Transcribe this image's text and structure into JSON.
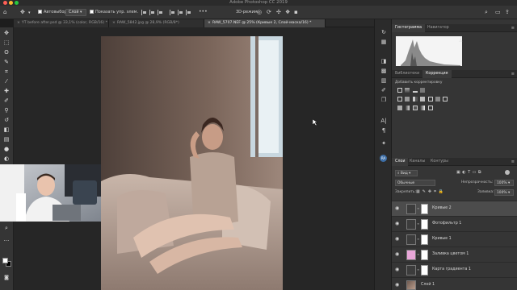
{
  "window": {
    "title": "Adobe Photoshop CC 2019",
    "traffic_lights": [
      "#ff5f57",
      "#febc2e",
      "#28c840"
    ]
  },
  "options_bar": {
    "auto_select_label": "Автовыбор:",
    "auto_select_value": "Слой",
    "show_transform_label": "Показать упр. элем.",
    "mode_3d_label": "3D-режим:"
  },
  "doc_tabs": [
    {
      "label": "YT before after.psd @ 33,1% (color, RGB/16) *"
    },
    {
      "label": "RAW_5842.jpg @ 28,9% (RGB/8*)"
    },
    {
      "label": "RAW_5707.NEF @ 25% (Кривые 2, Слой-маска/16) *"
    }
  ],
  "panels": {
    "histogram": {
      "tabs": [
        "Гистограмма",
        "Навигатор"
      ]
    },
    "adjustments": {
      "tabs": [
        "Библиотеки",
        "Коррекция"
      ],
      "hint": "Добавить корректировку"
    },
    "layers": {
      "tabs": [
        "Слои",
        "Каналы",
        "Контуры"
      ],
      "kind_label": "Вид",
      "blend_mode": "Обычные",
      "opacity_label": "Непрозрачность:",
      "opacity_value": "100%",
      "lock_label": "Закрепить:",
      "fill_label": "Заливка:",
      "fill_value": "100%",
      "items": [
        {
          "name": "Кривые 2",
          "selected": true,
          "thumb": "curves"
        },
        {
          "name": "Фотофильтр 1",
          "selected": false,
          "thumb": "photofilter"
        },
        {
          "name": "Кривые 1",
          "selected": false,
          "thumb": "curves"
        },
        {
          "name": "Заливка цветом 1",
          "selected": false,
          "thumb": "fill",
          "thumb_color": "#e8a6d8"
        },
        {
          "name": "Карта градиента 1",
          "selected": false,
          "thumb": "gradient"
        },
        {
          "name": "Слой 1",
          "selected": false,
          "thumb": "photo"
        }
      ]
    }
  },
  "icons": {
    "toolbar": [
      "move-icon",
      "marquee-icon",
      "lasso-icon",
      "quick-select-icon",
      "crop-icon",
      "eyedropper-icon",
      "healing-icon",
      "brush-icon",
      "stamp-icon",
      "history-brush-icon",
      "eraser-icon",
      "gradient-icon",
      "blur-icon",
      "dodge-icon",
      "pen-icon",
      "type-icon",
      "path-select-icon",
      "shape-icon",
      "hand-icon",
      "zoom-icon"
    ]
  }
}
